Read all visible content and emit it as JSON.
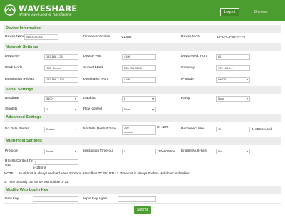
{
  "header": {
    "brand": "WAVESHARE",
    "slogan": "share awesome hardware",
    "logout": "Logout",
    "chinese": "Chinese"
  },
  "sections": {
    "device_info": "Device Information",
    "network": "Network Settings",
    "serial": "Serial Settings",
    "advanced": "Advanced Settings",
    "multi_host": "Multi-Host Settings",
    "web_login": "Modify Web Login Key"
  },
  "device_info": {
    "name_label": "Device Name",
    "name_value": "WSDEV0001",
    "fw_label": "Firmware Version",
    "fw_value": "V1.452",
    "mac_label": "Device MAC",
    "mac_value": "28-62-C5-0B-7F-F5"
  },
  "network": {
    "ip_label": "Device IP",
    "ip_value": "192.168.1.26",
    "port_label": "Device Port",
    "port_value": "4196",
    "webport_label": "Device Web Port",
    "webport_value": "80",
    "workmode_label": "Work Mode",
    "workmode_value": "TCP Server",
    "mask_label": "Subnet Mask",
    "mask_value": "255.255.255.0",
    "gateway_label": "Gateway",
    "gateway_value": "192.168.1.1",
    "destip_label": "Destination IP/DNS",
    "destip_value": "192.168.1.100",
    "destport_label": "Destination Port",
    "destport_value": "4196",
    "ipmode_label": "IP mode",
    "ipmode_value": "DHCP"
  },
  "serial": {
    "baud_label": "Baudrate",
    "baud_value": "9600",
    "databits_label": "Databits",
    "databits_value": "8",
    "parity_label": "Parity",
    "parity_value": "None",
    "stopbits_label": "Stopbits",
    "stopbits_value": "1",
    "flow_label": "Flow control",
    "flow_value": "None"
  },
  "advanced": {
    "nodata_restart_label": "No Data Restart",
    "nodata_restart_value": "Enable",
    "nodata_time_label": "No Data Restart Time",
    "nodata_time_value": "300",
    "nodata_time_unit": "second",
    "nodata_time_range": "0~1270",
    "reconnect_label": "Reconnect time",
    "reconnect_value": "12",
    "reconnect_range": "1~255 second"
  },
  "multi_host": {
    "protocol_label": "Protocol",
    "protocol_value": "None",
    "timeout_label": "Instruction Time-out",
    "timeout_value": "5",
    "timeout_range": "32~6000ms",
    "enable_label": "Enable Multi-host",
    "enable_value": "No",
    "rs485_label_1": "RS485 Conflict Time",
    "rs485_label_2": "Gap",
    "rs485_value": "0",
    "rs485_range": "5~255ms",
    "note1": "NOTE: 1. Multi-host is always enabled when Protocol is Modbus TCP to RTU  2. Time out is always 0 when Multi-host is disabled",
    "note2": "3. Time out only can be set as multiple of 32."
  },
  "web_login": {
    "new_key_label": "New Key",
    "new_key_value": "",
    "again_label": "Input Key Again",
    "again_value": ""
  },
  "submit": "Submit",
  "colors": {
    "brand_green": "#4c9d2f",
    "section_title_green": "#3c8a22",
    "section_bg": "#ececec"
  }
}
